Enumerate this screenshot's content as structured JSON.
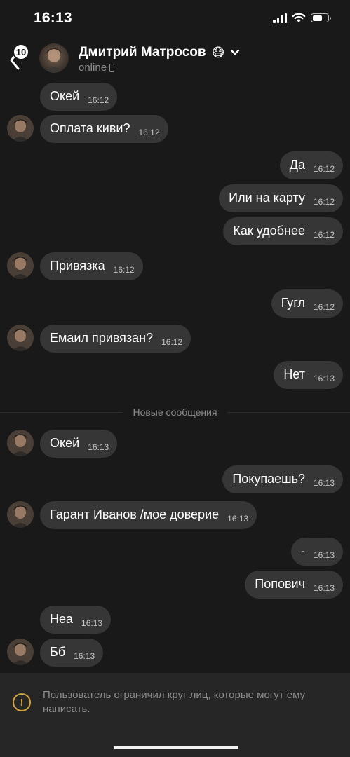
{
  "status_bar": {
    "time": "16:13",
    "battery_level": 0.62
  },
  "header": {
    "back_badge": "10",
    "name": "Дмитрий Матросов",
    "name_emoji": "😷",
    "status": "online"
  },
  "messages": [
    {
      "dir": "in",
      "text": "Окей",
      "time": "16:12",
      "avatar": false
    },
    {
      "dir": "in",
      "text": "Оплата киви?",
      "time": "16:12",
      "avatar": true
    },
    {
      "dir": "out",
      "text": "Да",
      "time": "16:12"
    },
    {
      "dir": "out",
      "text": "Или на карту",
      "time": "16:12"
    },
    {
      "dir": "out",
      "text": "Как удобнее",
      "time": "16:12"
    },
    {
      "dir": "in",
      "text": "Привязка",
      "time": "16:12",
      "avatar": true
    },
    {
      "dir": "out",
      "text": "Гугл",
      "time": "16:12"
    },
    {
      "dir": "in",
      "text": "Емаил привязан?",
      "time": "16:12",
      "avatar": true
    },
    {
      "dir": "out",
      "text": "Нет",
      "time": "16:13"
    },
    {
      "dir": "in",
      "text": "Окей",
      "time": "16:13",
      "avatar": true
    },
    {
      "dir": "out",
      "text": "Покупаешь?",
      "time": "16:13"
    },
    {
      "dir": "in",
      "text": "Гарант Иванов /мое доверие",
      "time": "16:13",
      "avatar": true
    },
    {
      "dir": "out",
      "text": "-",
      "time": "16:13"
    },
    {
      "dir": "out",
      "text": "Попович",
      "time": "16:13"
    },
    {
      "dir": "in",
      "text": "Неа",
      "time": "16:13",
      "avatar": false
    },
    {
      "dir": "in",
      "text": "Бб",
      "time": "16:13",
      "avatar": true
    }
  ],
  "new_messages_divider": "Новые сообщения",
  "restriction": {
    "icon": "warning-icon",
    "text": "Пользователь ограничил круг лиц, которые могут ему написать."
  },
  "colors": {
    "background": "#191919",
    "bubble": "#363636",
    "warning": "#d4a437"
  }
}
